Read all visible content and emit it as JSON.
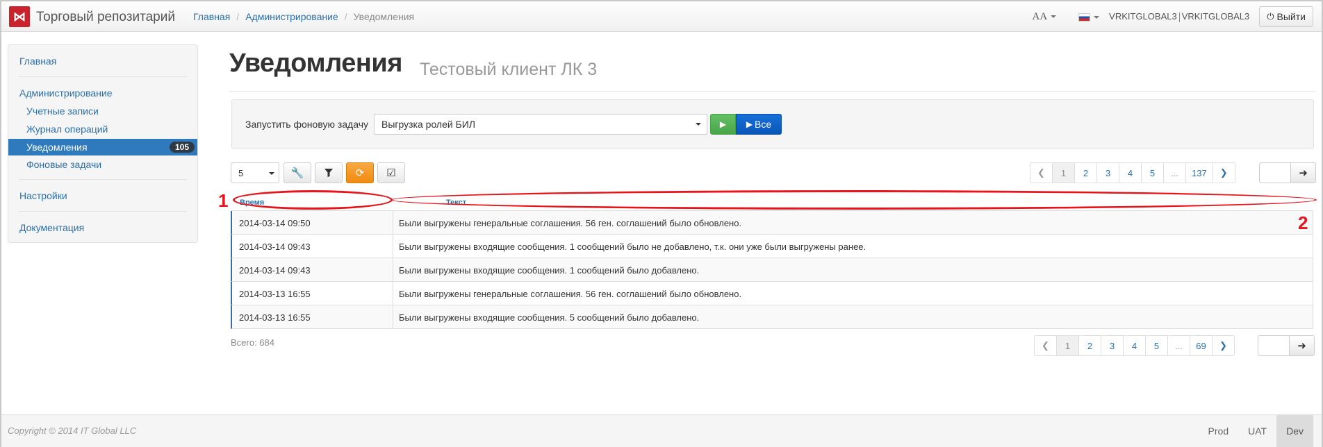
{
  "app": {
    "logo_glyph": "⋈",
    "title": "Торговый репозитарий"
  },
  "breadcrumb": {
    "items": [
      "Главная",
      "Администрирование"
    ],
    "current": "Уведомления",
    "separator": "/"
  },
  "nav": {
    "font_toggle": "AA",
    "user": "VRKITGLOBAL3",
    "org": "VRKITGLOBAL3",
    "logout_label": "Выйти",
    "logout_icon": "power-icon"
  },
  "sidebar": {
    "home": "Главная",
    "admin": "Администрирование",
    "accounts": "Учетные записи",
    "journal": "Журнал операций",
    "notifications": "Уведомления",
    "notifications_badge": "105",
    "background_tasks": "Фоновые задачи",
    "settings": "Настройки",
    "docs": "Документация"
  },
  "header": {
    "title": "Уведомления",
    "subtitle": "Тестовый клиент ЛК 3"
  },
  "task_panel": {
    "label": "Запустить фоновую задачу",
    "selected_task": "Выгрузка ролей БИЛ",
    "run_icon": "play-icon",
    "run_all_label": "Все"
  },
  "toolbar": {
    "page_size": "5",
    "buttons": [
      "wrench-icon",
      "filter-icon",
      "refresh-icon",
      "checkbox-icon"
    ]
  },
  "pagination_top": {
    "pages": [
      "1",
      "2",
      "3",
      "4",
      "5",
      "...",
      "137"
    ],
    "active": "1"
  },
  "pagination_bottom": {
    "pages": [
      "1",
      "2",
      "3",
      "4",
      "5",
      "...",
      "69"
    ],
    "active": "1"
  },
  "table": {
    "columns": [
      "Время",
      "Текст"
    ],
    "rows": [
      {
        "time": "2014-03-14 09:50",
        "text": "Были выгружены генеральные соглашения. 56 ген. соглашений было обновлено."
      },
      {
        "time": "2014-03-14 09:43",
        "text": "Были выгружены входящие сообщения. 1 сообщений было не добавлено, т.к. они уже были выгружены ранее."
      },
      {
        "time": "2014-03-14 09:43",
        "text": "Были выгружены входящие сообщения. 1 сообщений было добавлено."
      },
      {
        "time": "2014-03-13 16:55",
        "text": "Были выгружены генеральные соглашения. 56 ген. соглашений было обновлено."
      },
      {
        "time": "2014-03-13 16:55",
        "text": "Были выгружены входящие сообщения. 5 сообщений было добавлено."
      }
    ]
  },
  "annotations": {
    "label_1": "1",
    "label_2": "2",
    "color": "#e8141a"
  },
  "total": "Всего: 684",
  "footer": {
    "copyright": "Copyright © 2014 IT Global LLC",
    "envs": [
      "Prod",
      "UAT",
      "Dev"
    ],
    "active_env": "Dev"
  },
  "colors": {
    "accent": "#2a6fb2",
    "active_nav": "#2f79bd",
    "brand_red": "#c9242b",
    "run_green": "#4aa54a",
    "run_all_blue": "#0a55b8",
    "refresh_orange": "#f08a10"
  }
}
